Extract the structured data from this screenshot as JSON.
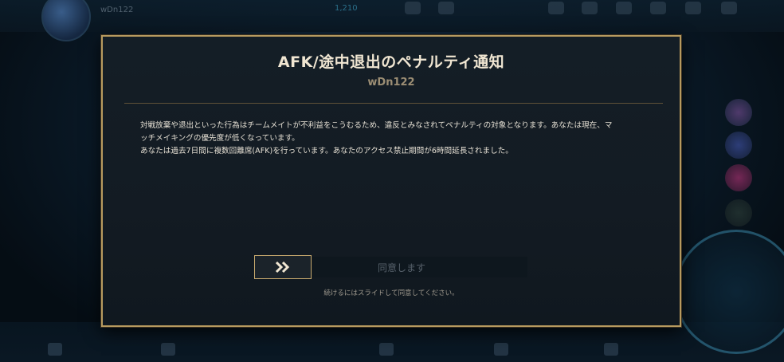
{
  "background": {
    "player_name": "wDn122",
    "currency": "1,210"
  },
  "dialog": {
    "title": "AFK/途中退出のペナルティ通知",
    "subtitle": "wDn122",
    "body_line1": "対戦放棄や退出といった行為はチームメイトが不利益をこうむるため、違反とみなされてペナルティの対象となります。あなたは現在、マ",
    "body_line2": "ッチメイキングの優先度が低くなっています。",
    "body_line3": "あなたは過去7日間に複数回離席(AFK)を行っています。あなたのアクセス禁止期間が6時間延長されました。",
    "slider_label": "同意します",
    "hint": "続けるにはスライドして同意してください。"
  },
  "colors": {
    "accent_gold": "#c8aa6e",
    "title_text": "#f0e6d2",
    "panel_bg": "#141e26"
  },
  "icons": {
    "slider_handle": "double-chevron-right-icon"
  }
}
